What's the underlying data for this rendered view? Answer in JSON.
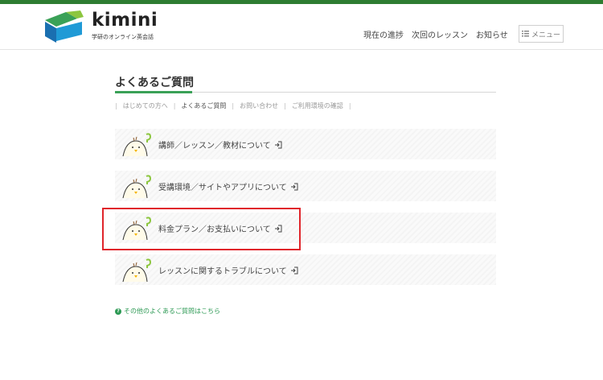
{
  "brand": {
    "name": "kimini",
    "tagline": "学研のオンライン英会話",
    "colors": {
      "green": "#3aa157",
      "blue": "#1f9ad6",
      "lime": "#8cc63f"
    }
  },
  "nav": {
    "progress": "現在の進捗",
    "next_lesson": "次回のレッスン",
    "news": "お知らせ",
    "menu_label": "メニュー",
    "menu_icon": "list-icon"
  },
  "faq": {
    "title": "よくあるご質問",
    "subnav": [
      "はじめての方へ",
      "よくあるご質問",
      "お問い合わせ",
      "ご利用環境の確認"
    ],
    "active_subnav": "よくあるご質問",
    "categories": [
      {
        "label": "講師／レッスン／教材について",
        "icon": "question-chick-icon"
      },
      {
        "label": "受講環境／サイトやアプリについて",
        "icon": "question-chick-icon"
      },
      {
        "label": "料金プラン／お支払いについて",
        "icon": "question-chick-icon"
      },
      {
        "label": "レッスンに関するトラブルについて",
        "icon": "question-chick-icon"
      }
    ],
    "highlighted": "料金プラン／お支払いについて",
    "more_link": "その他のよくあるご質問はこちら"
  }
}
